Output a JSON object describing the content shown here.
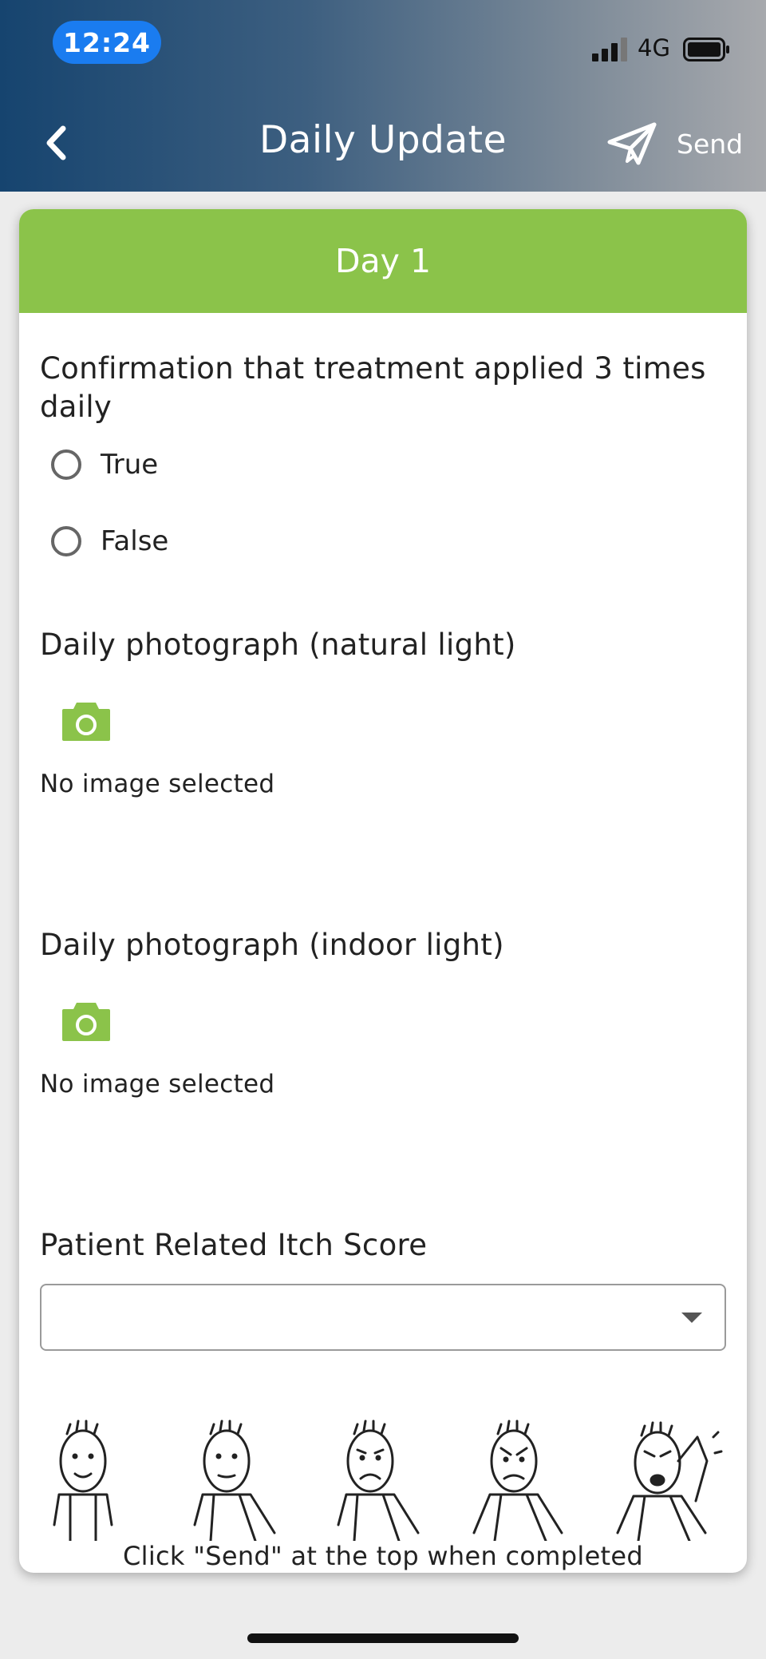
{
  "status_bar": {
    "time": "12:24",
    "network": "4G"
  },
  "header": {
    "title": "Daily Update",
    "send_label": "Send",
    "back_icon": "chevron-left-icon",
    "send_icon": "paper-plane-icon"
  },
  "card": {
    "day_label": "Day 1",
    "accent_color": "#8bc34a",
    "treatment_question": "Confirmation that treatment applied 3 times daily",
    "options": [
      "True",
      "False"
    ],
    "photo_natural": {
      "label": "Daily photograph (natural light)",
      "status": "No image selected",
      "icon": "camera-icon"
    },
    "photo_indoor": {
      "label": "Daily photograph (indoor light)",
      "status": "No image selected",
      "icon": "camera-icon"
    },
    "itch_score": {
      "label": "Patient Related Itch Score",
      "selected_value": "",
      "faces": [
        "no-itch-face",
        "mild-itch-face",
        "moderate-itch-face",
        "severe-itch-face",
        "very-severe-itch-face"
      ]
    },
    "footer_note": "Click \"Send\" at the top when completed"
  }
}
